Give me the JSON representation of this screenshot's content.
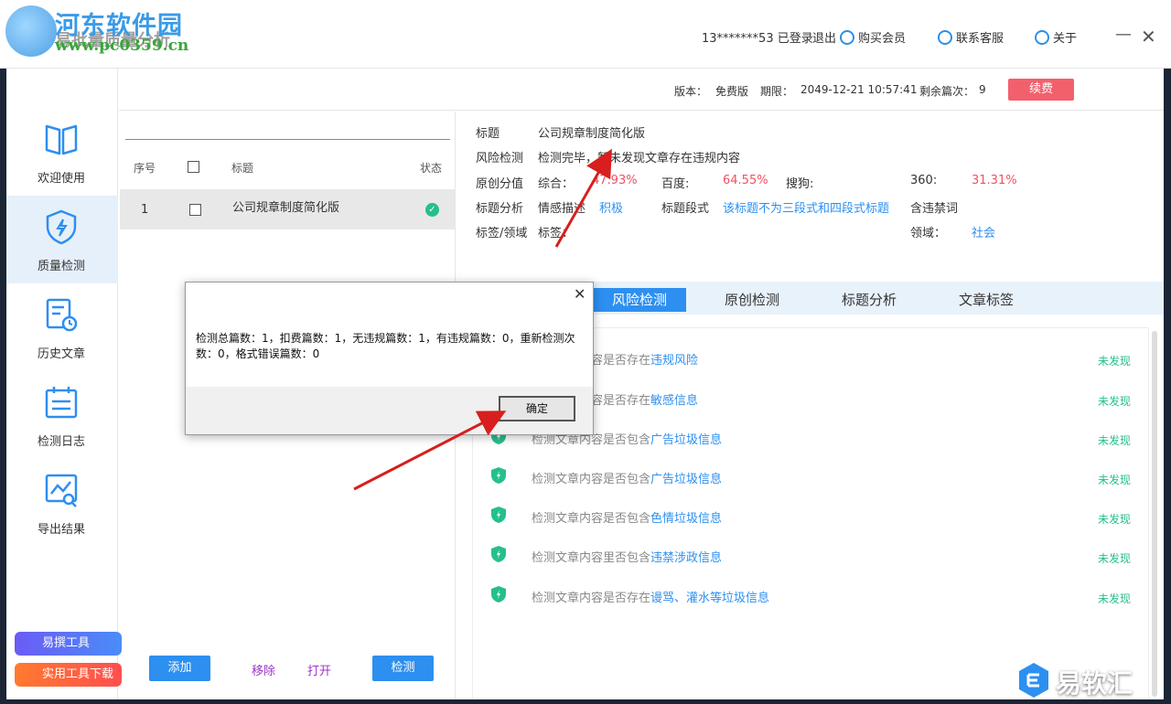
{
  "watermark": {
    "site": "河东软件园",
    "app_title": "易批量质量分析",
    "url": "www.pc0359.cn"
  },
  "titlebar": {
    "account": "13*******53 已登录",
    "logout": "退出",
    "buy_vip": "购买会员",
    "contact": "联系客服",
    "about": "关于",
    "minimize": "—",
    "maximize": "☐",
    "close": "✕"
  },
  "sidebar": {
    "items": [
      {
        "label": "欢迎使用",
        "icon": "book-icon"
      },
      {
        "label": "质量检测",
        "icon": "shield-bolt-icon"
      },
      {
        "label": "历史文章",
        "icon": "document-clock-icon"
      },
      {
        "label": "检测日志",
        "icon": "calendar-list-icon"
      },
      {
        "label": "导出结果",
        "icon": "chart-search-icon"
      }
    ],
    "promo1": "易撰工具",
    "promo2": "实用工具下载"
  },
  "infobar": {
    "version_label": "版本：",
    "version_value": "免费版",
    "expiry_label": "期限：",
    "expiry_value": "2049-12-21 10:57:41",
    "remaining_label": "剩余篇次：",
    "remaining_value": "9",
    "renew": "续费"
  },
  "list": {
    "headers": {
      "index": "序号",
      "title": "标题",
      "status": "状态"
    },
    "rows": [
      {
        "index": "1",
        "title": "公司规章制度简化版"
      }
    ],
    "buttons": {
      "add": "添加",
      "remove": "移除",
      "open": "打开",
      "detect": "检测"
    }
  },
  "detail": {
    "title_label": "标题",
    "title_value": "公司规章制度简化版",
    "risk_label": "风险检测",
    "risk_value": "检测完毕，暂未发现文章存在违规内容",
    "orig_label": "原创分值",
    "overall_label": "综合：",
    "overall_value": "47.93%",
    "baidu_label": "百度:",
    "baidu_value": "64.55%",
    "sogou_label": "搜狗:",
    "s360_label": "360:",
    "s360_value": "31.31%",
    "ta_label": "标题分析",
    "sentiment_label": "情感描述",
    "sentiment_value": "积极",
    "segment_label": "标题段式",
    "segment_value": "该标题不为三段式和四段式标题",
    "banned_label": "含违禁词",
    "tag_label": "标签/领域",
    "tag_sub": "标签：",
    "domain_label": "领域：",
    "domain_value": "社会"
  },
  "tabs": [
    "风险检测",
    "原创检测",
    "标题分析",
    "文章标签"
  ],
  "risks": [
    {
      "prefix": "检测文章内容是否存在",
      "keyword": "违规风险",
      "status": "未发现"
    },
    {
      "prefix": "检测文章内容是否存在",
      "keyword": "敏感信息",
      "status": "未发现"
    },
    {
      "prefix": "检测文章内容是否包含",
      "keyword": "广告垃圾信息",
      "status": "未发现"
    },
    {
      "prefix": "检测文章内容是否包含",
      "keyword": "广告垃圾信息",
      "status": "未发现"
    },
    {
      "prefix": "检测文章内容是否包含",
      "keyword": "色情垃圾信息",
      "status": "未发现"
    },
    {
      "prefix": "检测文章内容里否包含",
      "keyword": "违禁涉政信息",
      "status": "未发现"
    },
    {
      "prefix": "检测文章内容是否存在",
      "keyword": "谩骂、灌水等垃圾信息",
      "status": "未发现"
    }
  ],
  "dialog": {
    "message": "检测总篇数：1，扣费篇数：1，无违规篇数：1，有违规篇数：0，重新检测次数：0，格式错误篇数：0",
    "ok": "确定",
    "close": "✕"
  },
  "corner_logo": {
    "text": "易软汇"
  },
  "colors": {
    "accent": "#2d8ff0",
    "danger": "#f2505f",
    "success": "#25c08a",
    "purple": "#9b34c9"
  }
}
